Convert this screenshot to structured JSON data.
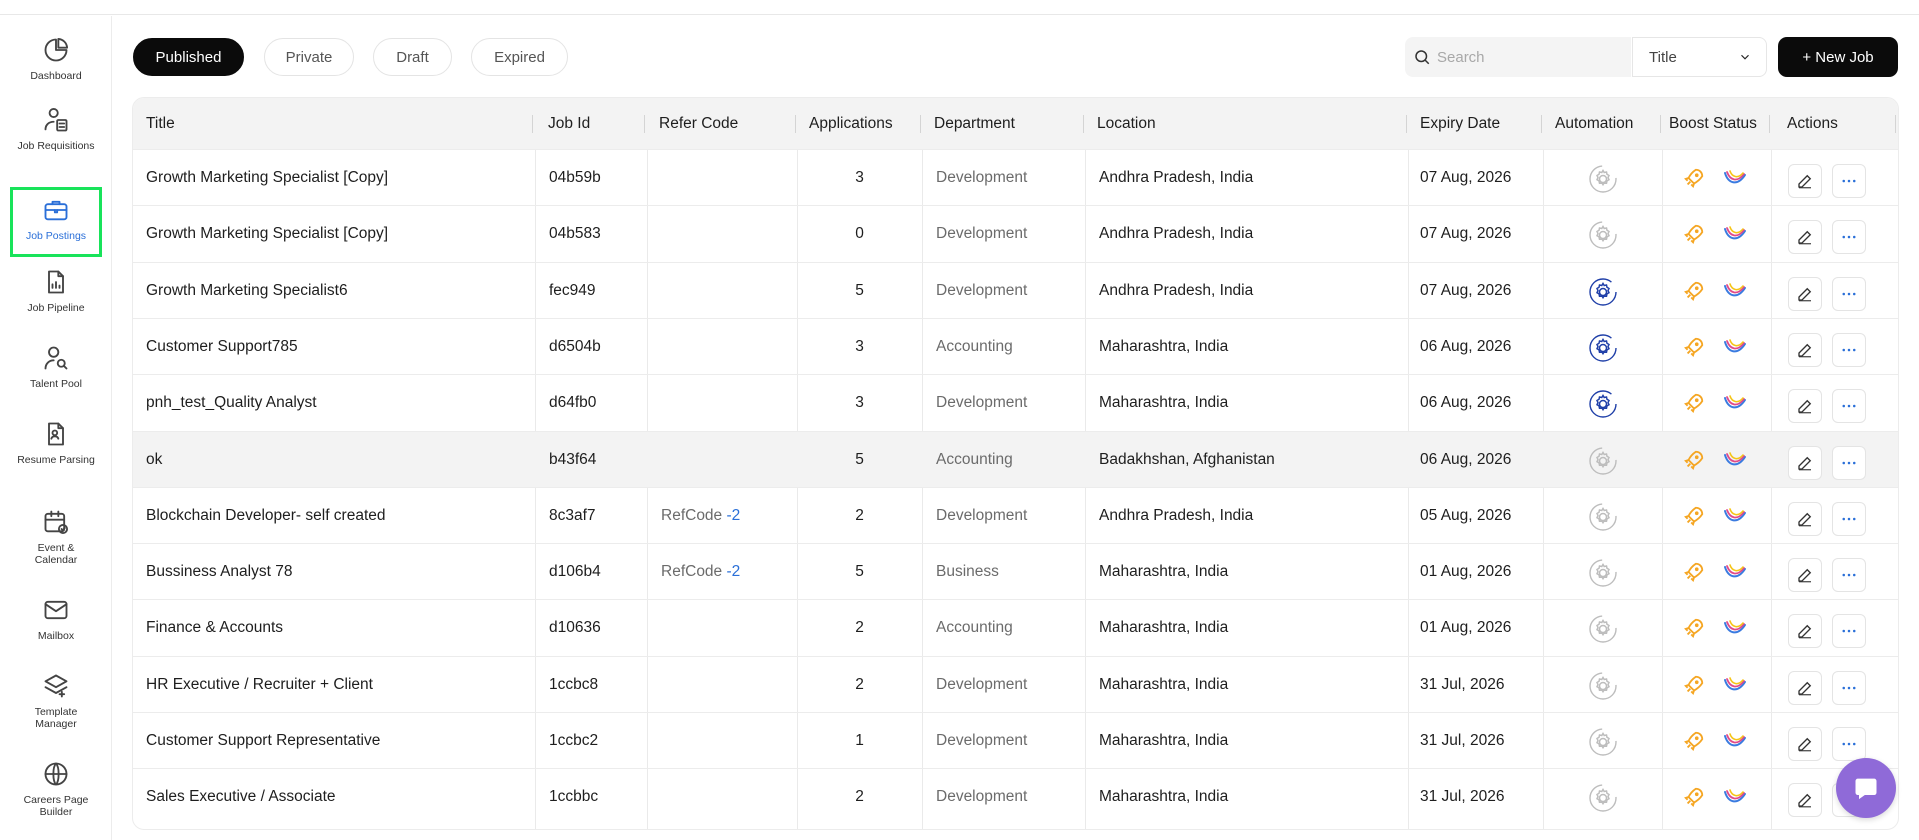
{
  "sidebar": {
    "items": [
      {
        "label": "Dashboard",
        "icon": "pie-chart-icon"
      },
      {
        "label": "Job Requisitions",
        "icon": "user-document-icon"
      },
      {
        "label": "Job Postings",
        "icon": "briefcase-icon",
        "active": true
      },
      {
        "label": "Job Pipeline",
        "icon": "chart-document-icon"
      },
      {
        "label": "Talent Pool",
        "icon": "user-search-icon"
      },
      {
        "label": "Resume Parsing",
        "icon": "resume-icon"
      },
      {
        "label": "Event & Calendar",
        "icon": "calendar-check-icon"
      },
      {
        "label": "Mailbox",
        "icon": "mail-icon"
      },
      {
        "label": "Template Manager",
        "icon": "layers-icon"
      },
      {
        "label": "Careers Page Builder",
        "icon": "globe-icon"
      }
    ]
  },
  "tabs": [
    {
      "label": "Published",
      "active": true
    },
    {
      "label": "Private"
    },
    {
      "label": "Draft"
    },
    {
      "label": "Expired"
    }
  ],
  "search": {
    "placeholder": "Search",
    "value": ""
  },
  "filter": {
    "selected": "Title"
  },
  "new_job_label": "+ New Job",
  "table": {
    "columns": [
      "Title",
      "Job Id",
      "Refer Code",
      "Applications",
      "Department",
      "Location",
      "Expiry Date",
      "Automation",
      "Boost Status",
      "Actions"
    ],
    "rows": [
      {
        "title": "Growth Marketing Specialist [Copy]",
        "job_id": "04b59b",
        "refer": "",
        "apps": "3",
        "dept": "Development",
        "loc": "Andhra Pradesh, India",
        "expiry": "07 Aug, 2026",
        "automation": "inactive"
      },
      {
        "title": "Growth Marketing Specialist [Copy]",
        "job_id": "04b583",
        "refer": "",
        "apps": "0",
        "dept": "Development",
        "loc": "Andhra Pradesh, India",
        "expiry": "07 Aug, 2026",
        "automation": "inactive"
      },
      {
        "title": "Growth Marketing Specialist6",
        "job_id": "fec949",
        "refer": "",
        "apps": "5",
        "dept": "Development",
        "loc": "Andhra Pradesh, India",
        "expiry": "07 Aug, 2026",
        "automation": "active"
      },
      {
        "title": "Customer Support785",
        "job_id": "d6504b",
        "refer": "",
        "apps": "3",
        "dept": "Accounting",
        "loc": "Maharashtra, India",
        "expiry": "06 Aug, 2026",
        "automation": "active"
      },
      {
        "title": "pnh_test_Quality Analyst",
        "job_id": "d64fb0",
        "refer": "",
        "apps": "3",
        "dept": "Development",
        "loc": "Maharashtra, India",
        "expiry": "06 Aug, 2026",
        "automation": "active"
      },
      {
        "title": "ok",
        "job_id": "b43f64",
        "refer": "",
        "apps": "5",
        "dept": "Accounting",
        "loc": "Badakhshan, Afghanistan",
        "expiry": "06 Aug, 2026",
        "automation": "inactive",
        "highlight": true
      },
      {
        "title": "Blockchain Developer- self created",
        "job_id": "8c3af7",
        "refer": "RefCode",
        "refer_num": "-2",
        "apps": "2",
        "dept": "Development",
        "loc": "Andhra Pradesh, India",
        "expiry": "05 Aug, 2026",
        "automation": "inactive"
      },
      {
        "title": "Bussiness Analyst 78",
        "job_id": "d106b4",
        "refer": "RefCode",
        "refer_num": "-2",
        "apps": "5",
        "dept": "Business",
        "loc": "Maharashtra, India",
        "expiry": "01 Aug, 2026",
        "automation": "inactive"
      },
      {
        "title": "Finance & Accounts",
        "job_id": "d10636",
        "refer": "",
        "apps": "2",
        "dept": "Accounting",
        "loc": "Maharashtra, India",
        "expiry": "01 Aug, 2026",
        "automation": "inactive"
      },
      {
        "title": "HR Executive / Recruiter + Client",
        "job_id": "1ccbc8",
        "refer": "",
        "apps": "2",
        "dept": "Development",
        "loc": "Maharashtra, India",
        "expiry": "31 Jul, 2026",
        "automation": "inactive"
      },
      {
        "title": "Customer Support Representative",
        "job_id": "1ccbc2",
        "refer": "",
        "apps": "1",
        "dept": "Development",
        "loc": "Maharashtra, India",
        "expiry": "31 Jul, 2026",
        "automation": "inactive"
      },
      {
        "title": "Sales Executive / Associate",
        "job_id": "1ccbbc",
        "refer": "",
        "apps": "2",
        "dept": "Development",
        "loc": "Maharashtra, India",
        "expiry": "31 Jul, 2026",
        "automation": "inactive"
      }
    ]
  },
  "colors": {
    "accent": "#2a6fd8",
    "active_highlight": "#18e35a",
    "boost_rocket": "#f5a623",
    "chat_fab": "#8f6ad8",
    "automation_active": "#1f3fa8",
    "automation_inactive": "#bdbdbd"
  }
}
